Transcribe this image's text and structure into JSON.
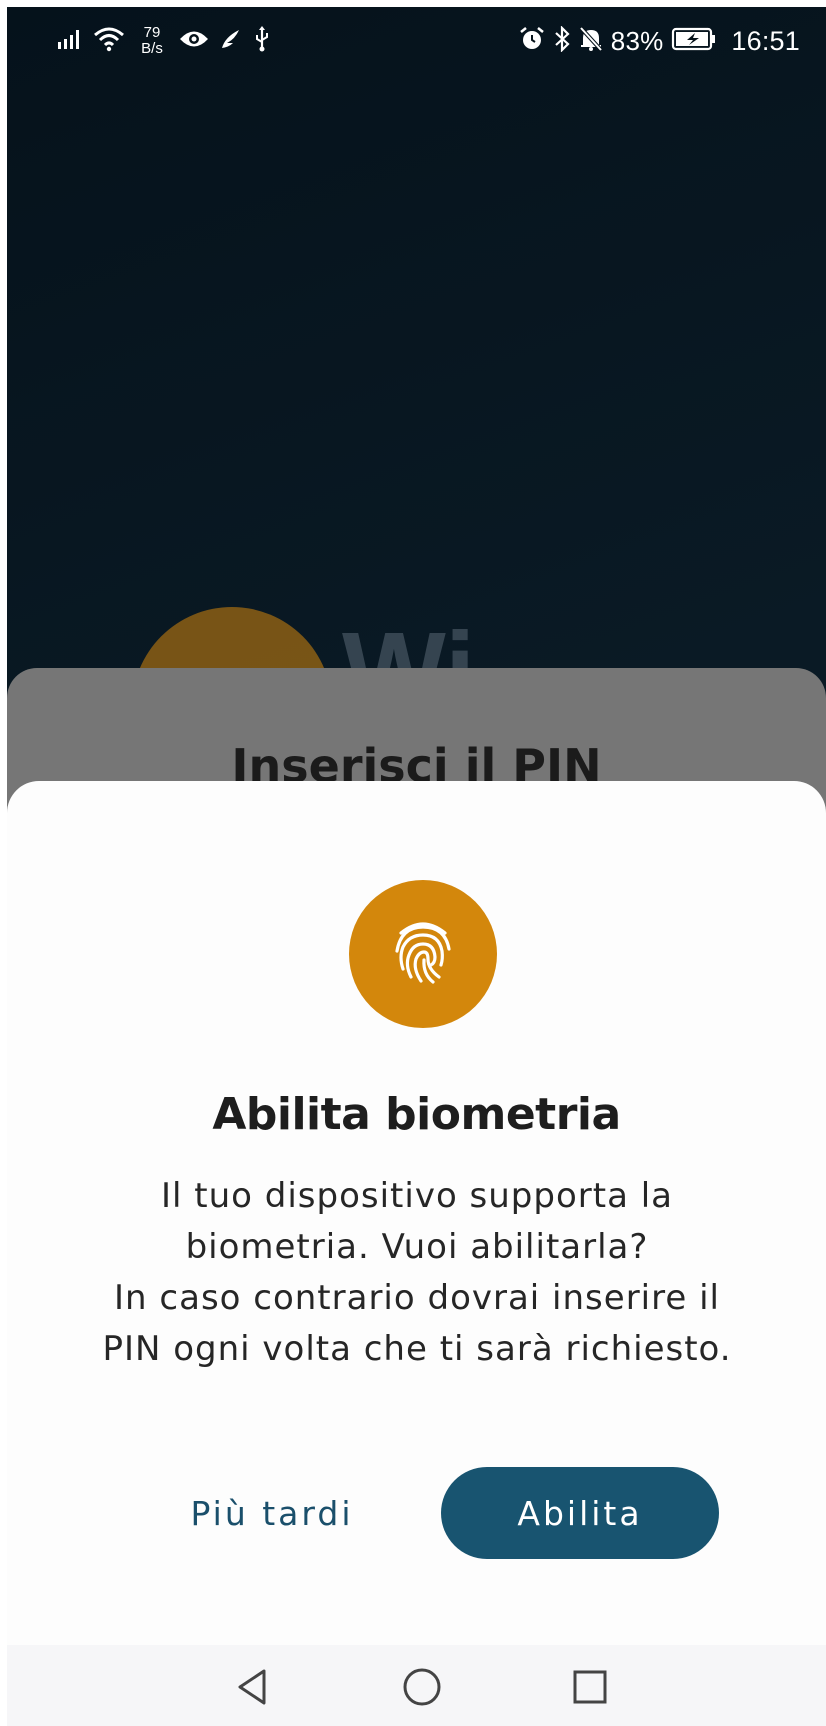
{
  "status_bar": {
    "net_speed_value": "79",
    "net_speed_unit": "B/s",
    "battery_percent": "83%",
    "time": "16:51",
    "icons_left": [
      "signal-icon",
      "wifi-icon",
      "eye-icon",
      "feather-icon",
      "usb-icon"
    ],
    "icons_right": [
      "alarm-icon",
      "bluetooth-icon",
      "mute-icon",
      "battery-charging-icon"
    ]
  },
  "background": {
    "logo_text": "Wi",
    "pin_title": "Inserisci il PIN"
  },
  "dialog": {
    "icon": "fingerprint-icon",
    "title": "Abilita biometria",
    "body_lines": [
      "Il tuo dispositivo supporta la",
      "biometria. Vuoi abilitarla?",
      "In caso contrario dovrai inserire il",
      "PIN ogni volta che ti sarà richiesto."
    ],
    "later_label": "Più tardi",
    "enable_label": "Abilita"
  },
  "colors": {
    "accent_orange": "#d3870c",
    "primary_blue": "#185470",
    "dark_background": "#06121a"
  },
  "nav_bar": {
    "buttons": [
      "back-icon",
      "home-icon",
      "recents-icon"
    ]
  }
}
